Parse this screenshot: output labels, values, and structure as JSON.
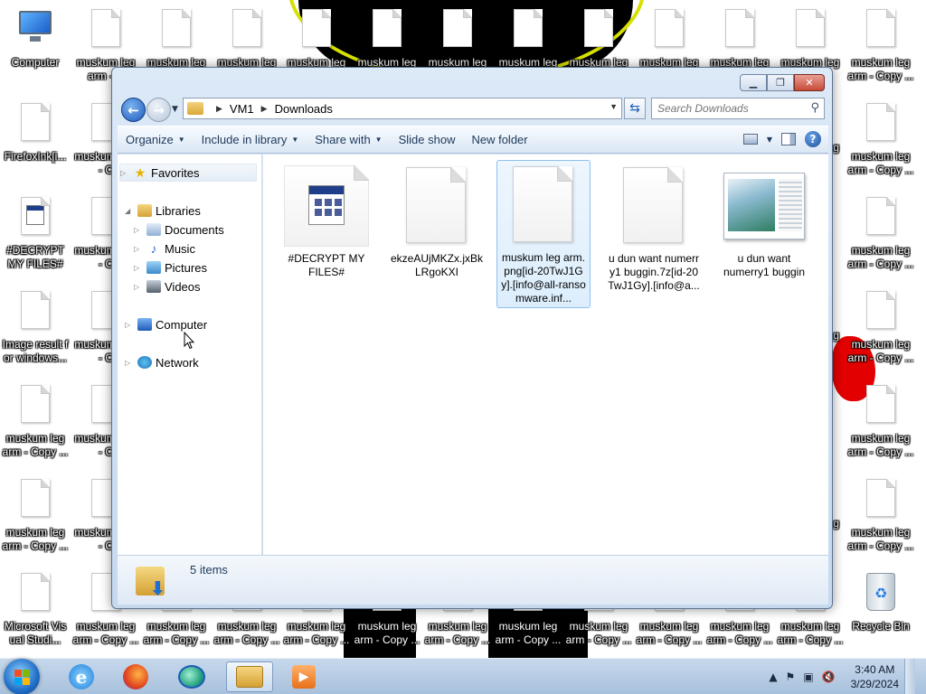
{
  "desktop": {
    "left_column": [
      {
        "label": "Computer",
        "icon": "computer-icon"
      },
      {
        "label": "FirefoxInk[i...",
        "icon": "document-icon"
      },
      {
        "label": "#DECRYPT MY FILES#",
        "icon": "html-document-icon"
      },
      {
        "label": "Image result for windows...",
        "icon": "document-icon"
      },
      {
        "label": "muskum leg arm - Copy ...",
        "icon": "document-icon"
      },
      {
        "label": "muskum leg arm - Copy ...",
        "icon": "document-icon"
      },
      {
        "label": "Microsoft Visual Studi...",
        "icon": "document-icon"
      }
    ],
    "top_row": [
      "muskum leg arm - C",
      "muskum leg",
      "muskum leg",
      "muskum leg",
      "muskum leg",
      "muskum leg",
      "muskum leg",
      "muskum leg",
      "muskum leg",
      "muskum leg",
      "muskum leg",
      "muskum leg arm - Copy ..."
    ],
    "second_column_partial": [
      "muskum arm - C",
      "muskum arm - C",
      "muskum arm - C",
      "muskum arm - C",
      "muskum arm - C",
      "muskum arm - C"
    ],
    "right_column": [
      {
        "label": "muskum leg arm - Copy ..."
      },
      {
        "label": "muskum leg arm - Copy ..."
      },
      {
        "label": "muskum leg arm - Copy ..."
      },
      {
        "label": "muskum leg arm - Copy ..."
      },
      {
        "label": "muskum leg arm - Copy ..."
      },
      {
        "label": "muskum leg arm - Copy ..."
      },
      {
        "label": "Recycle Bin",
        "icon": "recycle-bin-icon"
      }
    ],
    "right_partial_labels": [
      "g",
      "g",
      "g"
    ],
    "bottom_row": [
      "muskum leg arm - Copy ...",
      "muskum leg arm - Copy ...",
      "muskum leg arm - Copy ...",
      "muskum leg arm - Copy ...",
      "muskum leg arm - Copy ...",
      "muskum leg arm - Copy ...",
      "muskum leg arm - Copy ...",
      "muskum leg arm - Copy ...",
      "muskum leg arm - Copy ...",
      "muskum leg arm - Copy ...",
      "muskum leg arm - Copy ..."
    ]
  },
  "window": {
    "address": {
      "root": "VM1",
      "folder": "Downloads"
    },
    "search_placeholder": "Search Downloads",
    "commands": [
      {
        "label": "Organize",
        "dropdown": true
      },
      {
        "label": "Include in library",
        "dropdown": true
      },
      {
        "label": "Share with",
        "dropdown": true
      },
      {
        "label": "Slide show",
        "dropdown": false
      },
      {
        "label": "New folder",
        "dropdown": false
      }
    ],
    "nav": {
      "favorites": "Favorites",
      "libraries": "Libraries",
      "library_items": [
        "Documents",
        "Music",
        "Pictures",
        "Videos"
      ],
      "computer": "Computer",
      "network": "Network"
    },
    "files": [
      {
        "name": "#DECRYPT MY FILES#",
        "icon": "html-document-icon",
        "selected": false
      },
      {
        "name": "ekzeAUjMKZx.jxBkLRgoKXI",
        "icon": "blank-document-icon",
        "selected": false
      },
      {
        "name": "muskum leg arm.png[id-20TwJ1Gy].[info@all-ransomware.inf...",
        "icon": "blank-document-icon",
        "selected": true
      },
      {
        "name": "u dun want numerry1 buggin.7z[id-20TwJ1Gy].[info@a...",
        "icon": "blank-document-icon",
        "selected": false
      },
      {
        "name": "u dun want numerry1 buggin",
        "icon": "image-thumbnail-icon",
        "selected": false
      }
    ],
    "status": "5 items"
  },
  "taskbar": {
    "pinned": [
      "internet-explorer-icon",
      "firefox-icon",
      "edge-icon",
      "windows-explorer-icon",
      "media-player-icon"
    ],
    "clock": {
      "time": "3:40 AM",
      "date": "3/29/2024"
    }
  },
  "colors": {
    "accent": "#1d5ab8",
    "selection": "#dceefd",
    "window_frame": "#c6d9ef"
  }
}
